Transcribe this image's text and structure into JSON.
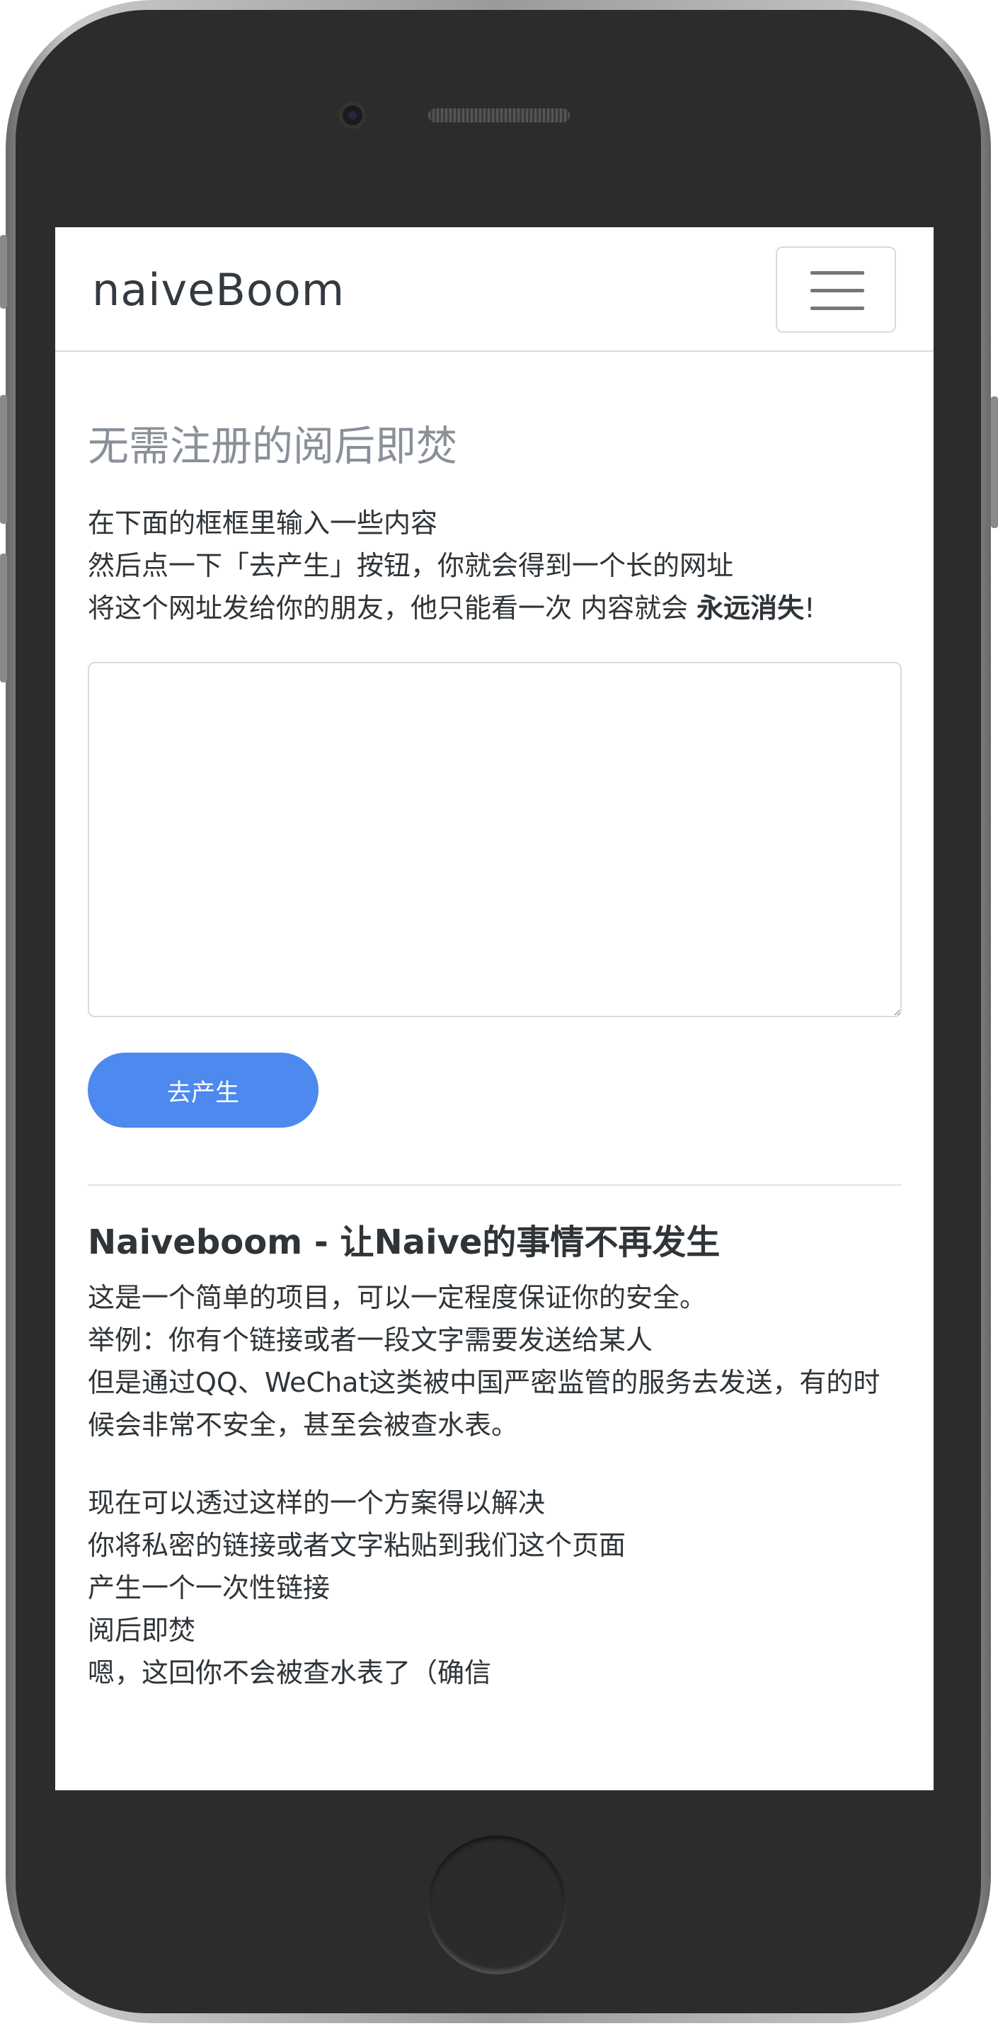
{
  "navbar": {
    "brand": "naiveBoom",
    "menu_icon": "hamburger-menu-icon"
  },
  "main": {
    "heading": "无需注册的阅后即焚",
    "intro_lines": [
      "在下面的框框里输入一些内容",
      "然后点一下「去产生」按钮，你就会得到一个长的网址",
      "将这个网址发给你的朋友，他只能看一次 内容就会 "
    ],
    "intro_bold": "永远消失",
    "intro_end": "!",
    "message_input_placeholder": "",
    "message_input_value": "",
    "generate_button": "去产生"
  },
  "about": {
    "title": "Naiveboom - 让Naive的事情不再发生",
    "paragraph1": [
      "这是一个简单的项目，可以一定程度保证你的安全。",
      "举例：你有个链接或者一段文字需要发送给某人",
      "但是通过QQ、WeChat这类被中国严密监管的服务去发送，有的时候会非常不安全，甚至会被查水表。"
    ],
    "paragraph2": [
      "现在可以透过这样的一个方案得以解决",
      "你将私密的链接或者文字粘贴到我们这个页面",
      "产生一个一次性链接",
      "阅后即焚",
      "嗯，这回你不会被查水表了（确信"
    ]
  },
  "colors": {
    "accent": "#4d89ee",
    "heading_gray": "#8a9099",
    "text": "#2f3438"
  }
}
